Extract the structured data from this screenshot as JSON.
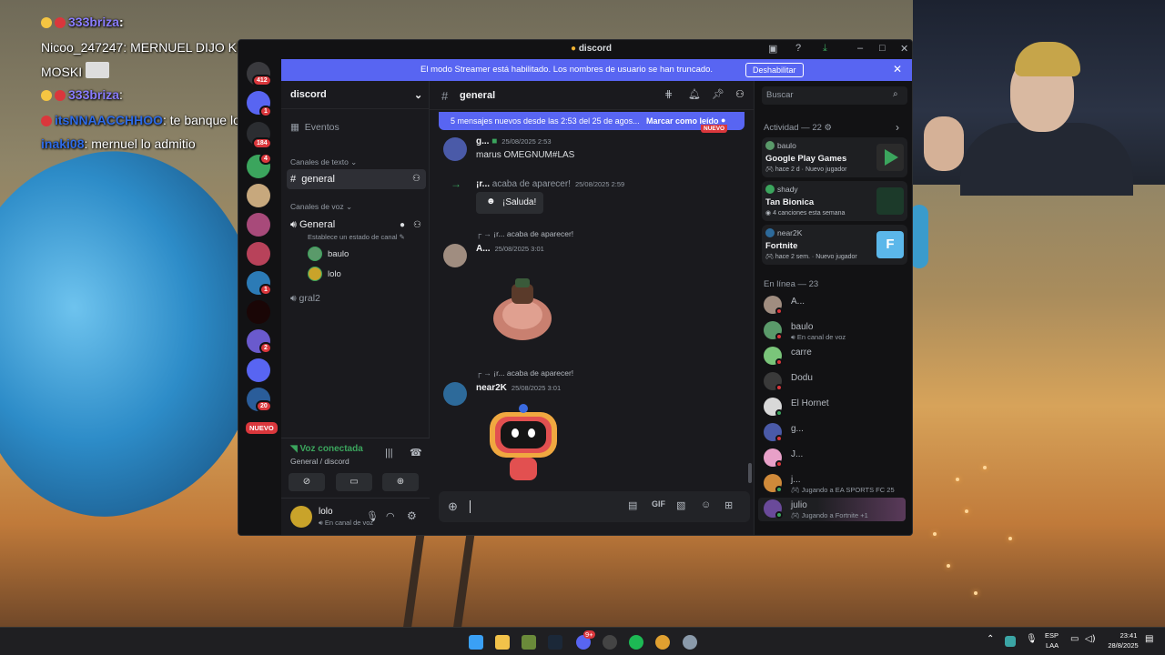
{
  "stream_chat": [
    {
      "user": "333briza",
      "text": "",
      "color": "#8a7dff"
    },
    {
      "user": "Nicoo_247247",
      "text": "MERNUEL DIJO KE RETIRASTE A",
      "color": "#ffffff"
    },
    {
      "user": "",
      "text": "MOSKI",
      "color": "#ffffff"
    },
    {
      "user": "333briza",
      "text": "",
      "color": "#8a7dff"
    },
    {
      "user": "itsNNAACCHHOO",
      "text": "te banque lolo",
      "color": "#2e6be6"
    },
    {
      "user": "inaki08",
      "text": "mernuel lo admitio",
      "color": "#2e6be6"
    }
  ],
  "window": {
    "title": "discord"
  },
  "banner": {
    "message": "El modo Streamer está habilitado. Los nombres de usuario se han truncado.",
    "button": "Deshabilitar"
  },
  "servers": [
    {
      "badge": "412",
      "color": "#3a3a3e"
    },
    {
      "badge": "1",
      "color": "#5865f2"
    },
    {
      "badge": "184",
      "color": "#2b2d31"
    },
    {
      "badge": "4",
      "color": "#3ba55d"
    },
    {
      "badge": "",
      "color": "#c7a87d"
    },
    {
      "badge": "",
      "color": "#a84a7a"
    },
    {
      "badge": "",
      "color": "#b8425a"
    },
    {
      "badge": "1",
      "color": "#2c7bb6"
    },
    {
      "badge": "",
      "color": "#1a0606"
    },
    {
      "badge": "2",
      "color": "#6a5acd"
    },
    {
      "badge": "",
      "color": "#5865f2"
    },
    {
      "badge": "20",
      "color": "#2a5d9a"
    }
  ],
  "servers_new_label": "NUEVO",
  "guild": {
    "name": "discord"
  },
  "channels": {
    "events": "Eventos",
    "text_header": "Canales de texto",
    "text_channel": "general",
    "voice_header": "Canales de voz",
    "voice_channel": "General",
    "voice_status": "Establece un estado de canal",
    "voice_users": [
      "baulo",
      "lolo"
    ],
    "voice_channel2": "gral2"
  },
  "voice_panel": {
    "status": "Voz conectada",
    "location": "General / discord"
  },
  "user_panel": {
    "name": "lolo",
    "status": "En canal de voz"
  },
  "chat_header": {
    "channel": "general",
    "search_placeholder": "Buscar"
  },
  "new_messages": {
    "text": "5 mensajes nuevos desde las 2:53 del 25 de agos...",
    "action": "Marcar como leído",
    "tag": "NUEVO"
  },
  "messages": {
    "m1": {
      "author": "g...",
      "time": "25/08/2025 2:53",
      "text": "marus OMEGNUM#LAS"
    },
    "m2": {
      "author": "¡r...",
      "event": "acaba de aparecer!",
      "time": "25/08/2025 2:59",
      "button": "¡Saluda!"
    },
    "m3": {
      "reply_author": "¡r...",
      "reply_text": "acaba de aparecer!",
      "author": "A...",
      "time": "25/08/2025 3:01"
    },
    "m4": {
      "reply_author": "¡r...",
      "reply_text": "acaba de aparecer!",
      "author": "near2K",
      "time": "25/08/2025 3:01"
    }
  },
  "activity": {
    "header": "Actividad — 22",
    "cards": [
      {
        "user": "baulo",
        "title": "Google Play Games",
        "sub": "hace 2 d",
        "extra": "Nuevo jugador",
        "thumb": "#2b2b2b"
      },
      {
        "user": "shady",
        "title": "Tan Bionica",
        "sub": "4 canciones esta semana",
        "extra": "",
        "thumb": "#1c3a2a"
      },
      {
        "user": "near2K",
        "title": "Fortnite",
        "sub": "hace 2 sem.",
        "extra": "Nuevo jugador",
        "thumb": "#5bb7ea"
      }
    ]
  },
  "online": {
    "header": "En línea — 23",
    "members": [
      {
        "name": "A...",
        "sub": "",
        "color": "#a08d80"
      },
      {
        "name": "baulo",
        "sub": "En canal de voz",
        "color": "#5a9a6a"
      },
      {
        "name": "carre",
        "sub": "",
        "color": "#7ac57a"
      },
      {
        "name": "Dodu",
        "sub": "",
        "color": "#3a3a3a"
      },
      {
        "name": "El Hornet",
        "sub": "",
        "color": "#d8d8d8"
      },
      {
        "name": "g...",
        "sub": "",
        "color": "#4a5aa8"
      },
      {
        "name": "J...",
        "sub": "",
        "color": "#e8a0c8"
      },
      {
        "name": "j...",
        "sub": "Jugando a EA SPORTS FC 25",
        "color": "#d08a3a"
      },
      {
        "name": "julio",
        "sub": "Jugando a Fortnite +1",
        "color": "#6a4a9a"
      }
    ]
  },
  "taskbar": {
    "lang": "ESP",
    "lang2": "LAA",
    "time": "23:41",
    "date": "28/8/2025",
    "discord_badge": "9+"
  }
}
